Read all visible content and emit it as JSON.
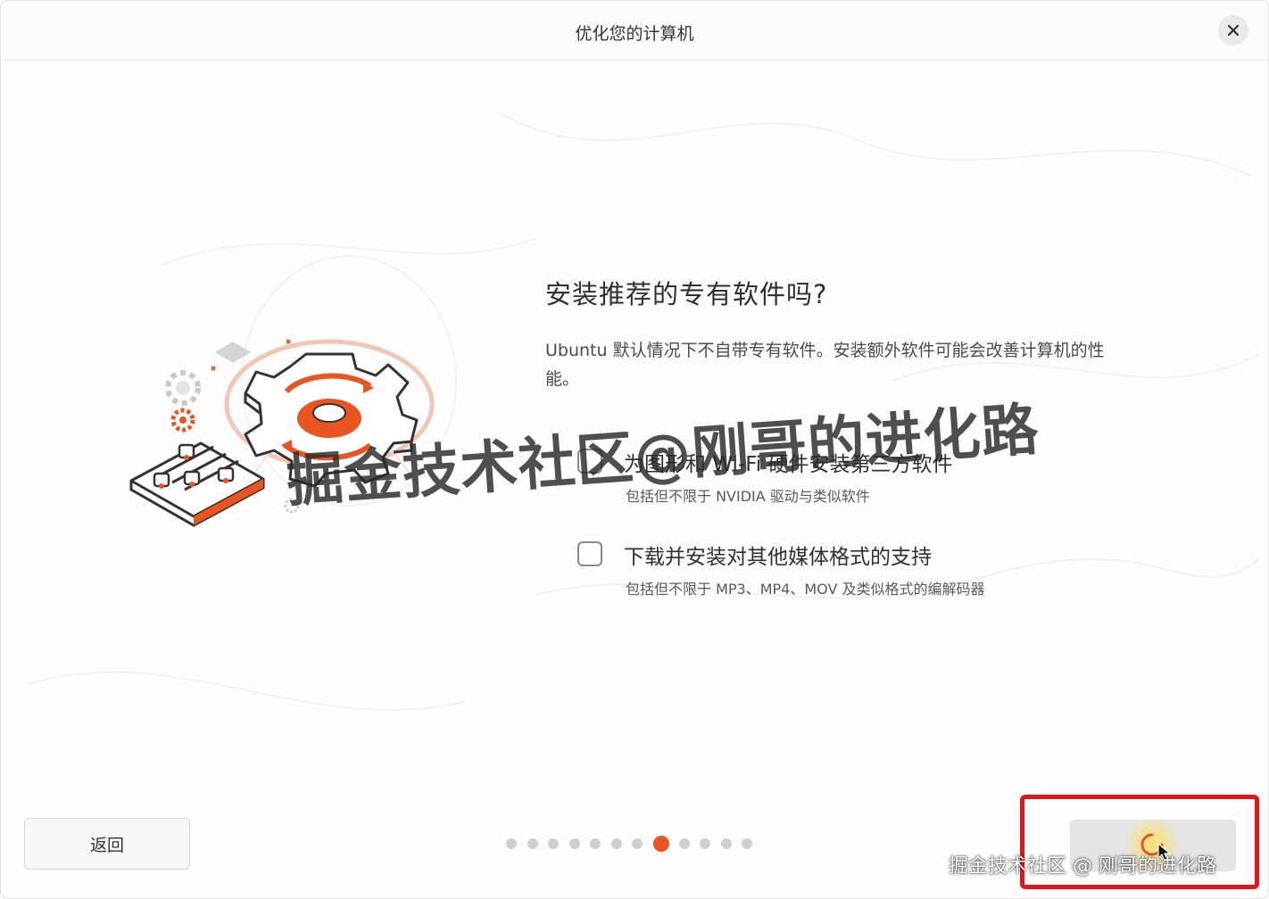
{
  "window": {
    "title": "优化您的计算机",
    "close_icon": "close-icon"
  },
  "main": {
    "heading": "安装推荐的专有软件吗?",
    "description": "Ubuntu 默认情况下不自带专有软件。安装额外软件可能会改善计算机的性能。",
    "options": [
      {
        "label": "为图形和 Wi-Fi 硬件安装第三方软件",
        "sublabel": "包括但不限于 NVIDIA 驱动与类似软件",
        "checked": false
      },
      {
        "label": "下载并安装对其他媒体格式的支持",
        "sublabel": "包括但不限于 MP3、MP4、MOV 及类似格式的编解码器",
        "checked": false
      }
    ],
    "illustration_icon": "gear-settings-illustration"
  },
  "footer": {
    "back_label": "返回",
    "progress": {
      "total_steps": 12,
      "current_step": 8
    },
    "next_state": "loading"
  },
  "overlay": {
    "watermark_main": "掘金技术社区@刚哥的进化路",
    "watermark_small": "掘金技术社区 @ 刚哥的进化路",
    "highlight_color": "#e3141a"
  },
  "colors": {
    "accent": "#e95420",
    "dot_inactive": "#cfcfcf",
    "background": "#fdfdfd"
  }
}
